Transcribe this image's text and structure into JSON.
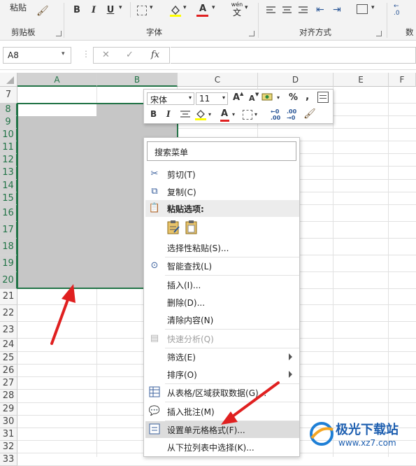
{
  "ribbon": {
    "paste_label": "粘贴",
    "clipboard_group": "剪贴板",
    "font_group": "字体",
    "alignment_group": "对齐方式",
    "number_group_partial": "数",
    "bold": "B",
    "italic": "I",
    "underline": "U",
    "wen_label": "wén",
    "wen_char": "文",
    "font_color_glyph": "A"
  },
  "formula_bar": {
    "name_box": "A8",
    "fx": "fx",
    "cancel_glyph": "✕",
    "enter_glyph": "✓",
    "formula": ""
  },
  "grid": {
    "columns": [
      "A",
      "B",
      "C",
      "D",
      "E",
      "F"
    ],
    "rows": [
      "7",
      "8",
      "9",
      "10",
      "11",
      "12",
      "13",
      "14",
      "15",
      "16",
      "17",
      "18",
      "19",
      "20",
      "21",
      "22",
      "23",
      "24",
      "25",
      "26",
      "27",
      "28",
      "29",
      "30",
      "31",
      "32",
      "33"
    ]
  },
  "mini_toolbar": {
    "font_name": "宋体",
    "font_size": "11",
    "grow_font": "A",
    "shrink_font": "A",
    "percent": "%",
    "comma": ",",
    "bold": "B",
    "italic": "I",
    "font_color": "A",
    "inc_decimal": "←0\n.00",
    "dec_decimal": ".00\n→0"
  },
  "context_menu": {
    "search_placeholder": "搜索菜单",
    "items": [
      {
        "label": "剪切(T)",
        "icon": "scissors-icon"
      },
      {
        "label": "复制(C)",
        "icon": "copy-icon"
      },
      {
        "label": "粘贴选项:",
        "icon": "paste-icon"
      },
      {
        "label": "选择性粘贴(S)...",
        "icon": ""
      },
      {
        "label": "智能查找(L)",
        "icon": "smart-lookup-icon"
      },
      {
        "label": "插入(I)...",
        "icon": ""
      },
      {
        "label": "删除(D)...",
        "icon": ""
      },
      {
        "label": "清除内容(N)",
        "icon": ""
      },
      {
        "label": "快速分析(Q)",
        "icon": "quick-analysis-icon"
      },
      {
        "label": "筛选(E)",
        "icon": ""
      },
      {
        "label": "排序(O)",
        "icon": ""
      },
      {
        "label": "从表格/区域获取数据(G)...",
        "icon": "table-icon"
      },
      {
        "label": "插入批注(M)",
        "icon": "comment-icon"
      },
      {
        "label": "设置单元格格式(F)...",
        "icon": "format-cells-icon"
      },
      {
        "label": "从下拉列表中选择(K)...",
        "icon": ""
      }
    ]
  },
  "watermark": {
    "brand": "极光下载站",
    "url": "www.xz7.com"
  },
  "colors": {
    "excel_green": "#217346",
    "selection_fill": "#c6c6c6",
    "arrow_red": "#e02020",
    "font_red": "#e02020",
    "highlight_yellow": "#ffff00"
  }
}
